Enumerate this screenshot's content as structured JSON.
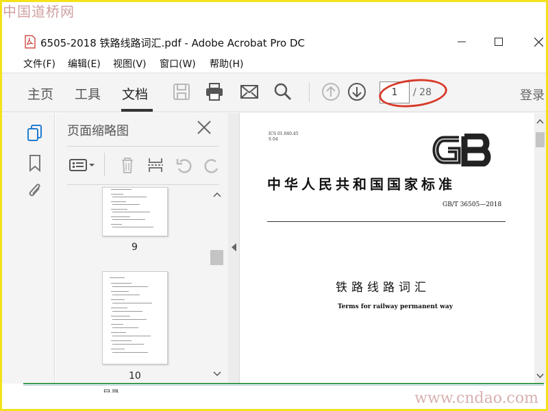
{
  "watermark": {
    "top": "中国道桥网",
    "bottom": "www.cndao.com"
  },
  "window": {
    "title": "6505-2018 铁路线路词汇.pdf - Adobe Acrobat Pro DC",
    "minimize_icon": "minimize-icon",
    "maximize_icon": "maximize-icon",
    "close_icon": "close-icon"
  },
  "menu": {
    "items": [
      "文件(F)",
      "编辑(E)",
      "视图(V)",
      "窗口(W)",
      "帮助(H)"
    ]
  },
  "toolbar": {
    "tabs": [
      "主页",
      "工具",
      "文档"
    ],
    "active_tab": "文档",
    "current_page": "1",
    "total_pages": "/ 28",
    "login": "登录",
    "icons": [
      "save-icon",
      "print-icon",
      "email-icon",
      "search-icon",
      "page-up-icon",
      "page-down-icon"
    ]
  },
  "sidebar": {
    "icons": [
      "page-thumbnails-icon",
      "bookmark-icon",
      "attachment-icon"
    ]
  },
  "panel": {
    "title": "页面缩略图",
    "tools": [
      "options-menu-icon",
      "delete-icon",
      "extract-icon",
      "rotate-ccw-icon",
      "rotate-cw-icon"
    ],
    "thumbnails": [
      {
        "label": "9"
      },
      {
        "label": "10"
      }
    ],
    "next_label": "目录"
  },
  "document": {
    "ics": "ICS 01.040.45",
    "class_code": "S 04",
    "logo": "GB",
    "national_standard": "中华人民共和国国家标准",
    "standard_code": "GB/T 36505—2018",
    "title_cn": "铁路线路词汇",
    "title_en": "Terms for railway permanent way"
  },
  "colors": {
    "frame": "#f3e21a",
    "annotation": "#d83a2a",
    "toolbar_bg": "#f4f4f4"
  }
}
